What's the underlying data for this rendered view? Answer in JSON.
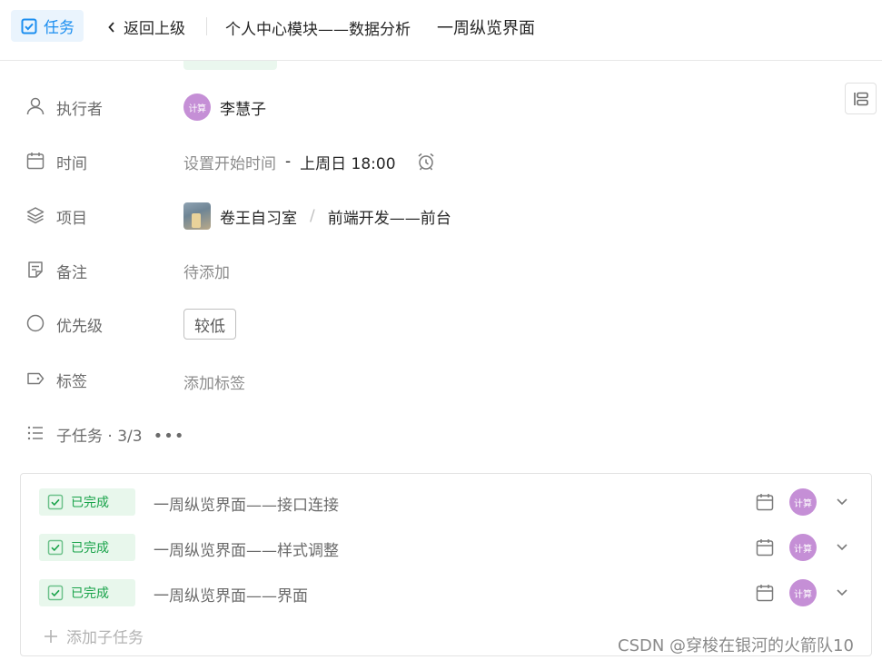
{
  "header": {
    "task_tag": "任务",
    "back_label": "返回上级",
    "breadcrumb": "个人中心模块——数据分析",
    "title": "一周纵览界面"
  },
  "fields": {
    "assignee": {
      "label": "执行者",
      "avatar_text": "计算",
      "name": "李慧子"
    },
    "time": {
      "label": "时间",
      "start_placeholder": "设置开始时间",
      "separator": "-",
      "due": "上周日 18:00"
    },
    "project": {
      "label": "项目",
      "project_name": "卷王自习室",
      "path_separator": "/",
      "task_list": "前端开发——前台"
    },
    "note": {
      "label": "备注",
      "placeholder": "待添加"
    },
    "priority": {
      "label": "优先级",
      "value": "较低"
    },
    "tags": {
      "label": "标签",
      "placeholder": "添加标签"
    },
    "subtasks": {
      "label": "子任务 · 3/3",
      "more": "•••"
    }
  },
  "subtasks": {
    "items": [
      {
        "status": "已完成",
        "title": "一周纵览界面——接口连接",
        "avatar_text": "计算"
      },
      {
        "status": "已完成",
        "title": "一周纵览界面——样式调整",
        "avatar_text": "计算"
      },
      {
        "status": "已完成",
        "title": "一周纵览界面——界面",
        "avatar_text": "计算"
      }
    ],
    "add_label": "添加子任务"
  },
  "watermark": "CSDN @穿梭在银河的火箭队10",
  "colors": {
    "accent": "#1b8ef0",
    "done_bg": "#e8f7ec",
    "done_text": "#19a34a",
    "avatar": "#c58fd6"
  }
}
